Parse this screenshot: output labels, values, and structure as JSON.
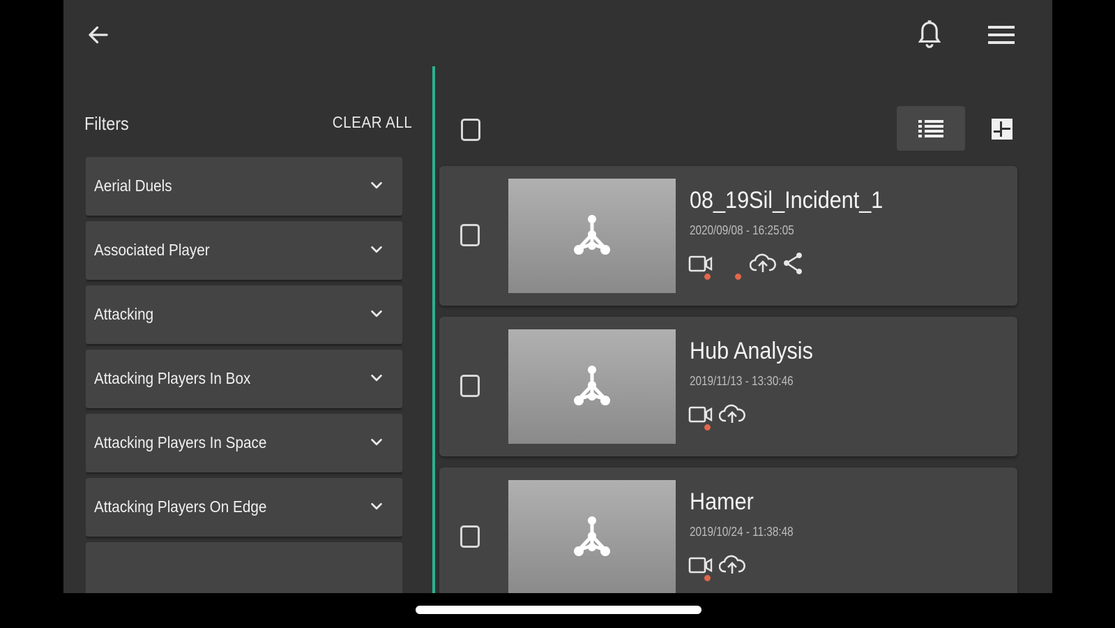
{
  "colors": {
    "accent": "#2bb08f",
    "background": "#323232",
    "panel": "#444444",
    "status_dot": "#e4664a"
  },
  "topbar": {
    "back_icon": "arrow-left-icon",
    "bell_icon": "bell-icon",
    "menu_icon": "hamburger-menu-icon"
  },
  "sidebar": {
    "title": "Filters",
    "clear_all": "CLEAR ALL",
    "filters": [
      {
        "label": "Aerial Duels"
      },
      {
        "label": "Associated Player"
      },
      {
        "label": "Attacking"
      },
      {
        "label": "Attacking Players In Box"
      },
      {
        "label": "Attacking Players In Space"
      },
      {
        "label": "Attacking Players On Edge"
      },
      {
        "label": ""
      }
    ]
  },
  "toolbar": {
    "list_view_icon": "list-view-icon",
    "grid_view_icon": "grid-view-icon"
  },
  "items": [
    {
      "title": "08_19Sil_Incident_1",
      "date": "2020/09/08 - 16:25:05",
      "actions": [
        "video-icon",
        "cloud-upload-icon",
        "share-icon"
      ]
    },
    {
      "title": "Hub Analysis",
      "date": "2019/11/13 - 13:30:46",
      "actions": [
        "video-icon",
        "cloud-upload-icon"
      ]
    },
    {
      "title": "Hamer",
      "date": "2019/10/24 - 11:38:48",
      "actions": [
        "video-icon",
        "cloud-upload-icon"
      ]
    }
  ]
}
